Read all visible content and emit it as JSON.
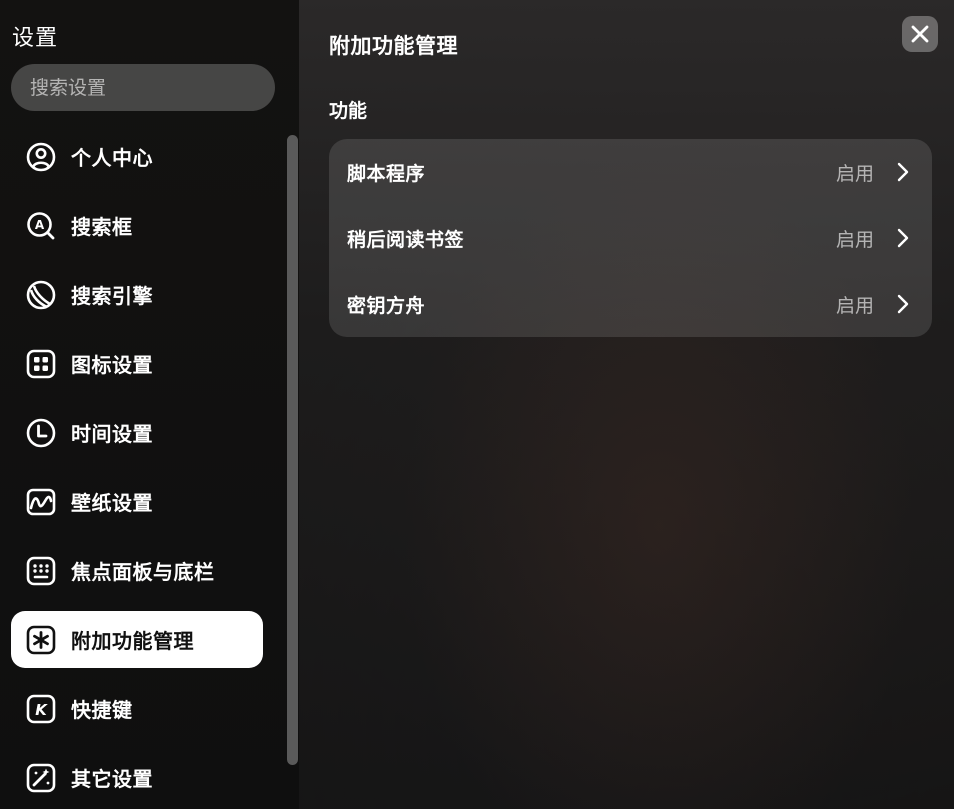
{
  "sidebar": {
    "title": "设置",
    "search": {
      "placeholder": "搜索设置",
      "value": ""
    },
    "items": [
      {
        "label": "个人中心",
        "icon": "user-icon",
        "active": false
      },
      {
        "label": "搜索框",
        "icon": "search-box-icon",
        "active": false
      },
      {
        "label": "搜索引擎",
        "icon": "search-engine-icon",
        "active": false
      },
      {
        "label": "图标设置",
        "icon": "icon-settings-icon",
        "active": false
      },
      {
        "label": "时间设置",
        "icon": "clock-icon",
        "active": false
      },
      {
        "label": "壁纸设置",
        "icon": "wallpaper-icon",
        "active": false
      },
      {
        "label": "焦点面板与底栏",
        "icon": "keyboard-icon",
        "active": false
      },
      {
        "label": "附加功能管理",
        "icon": "addon-icon",
        "active": true
      },
      {
        "label": "快捷键",
        "icon": "shortcut-icon",
        "active": false
      },
      {
        "label": "其它设置",
        "icon": "magic-wand-icon",
        "active": false
      }
    ]
  },
  "main": {
    "title": "附加功能管理",
    "section_title": "功能",
    "features": [
      {
        "name": "脚本程序",
        "status": "启用"
      },
      {
        "name": "稍后阅读书签",
        "status": "启用"
      },
      {
        "name": "密钥方舟",
        "status": "启用"
      }
    ]
  },
  "colors": {
    "accent_active_bg": "#ffffff",
    "text_primary": "#ffffff",
    "text_secondary": "#b0b0b0",
    "card_bg": "#3a3838"
  }
}
